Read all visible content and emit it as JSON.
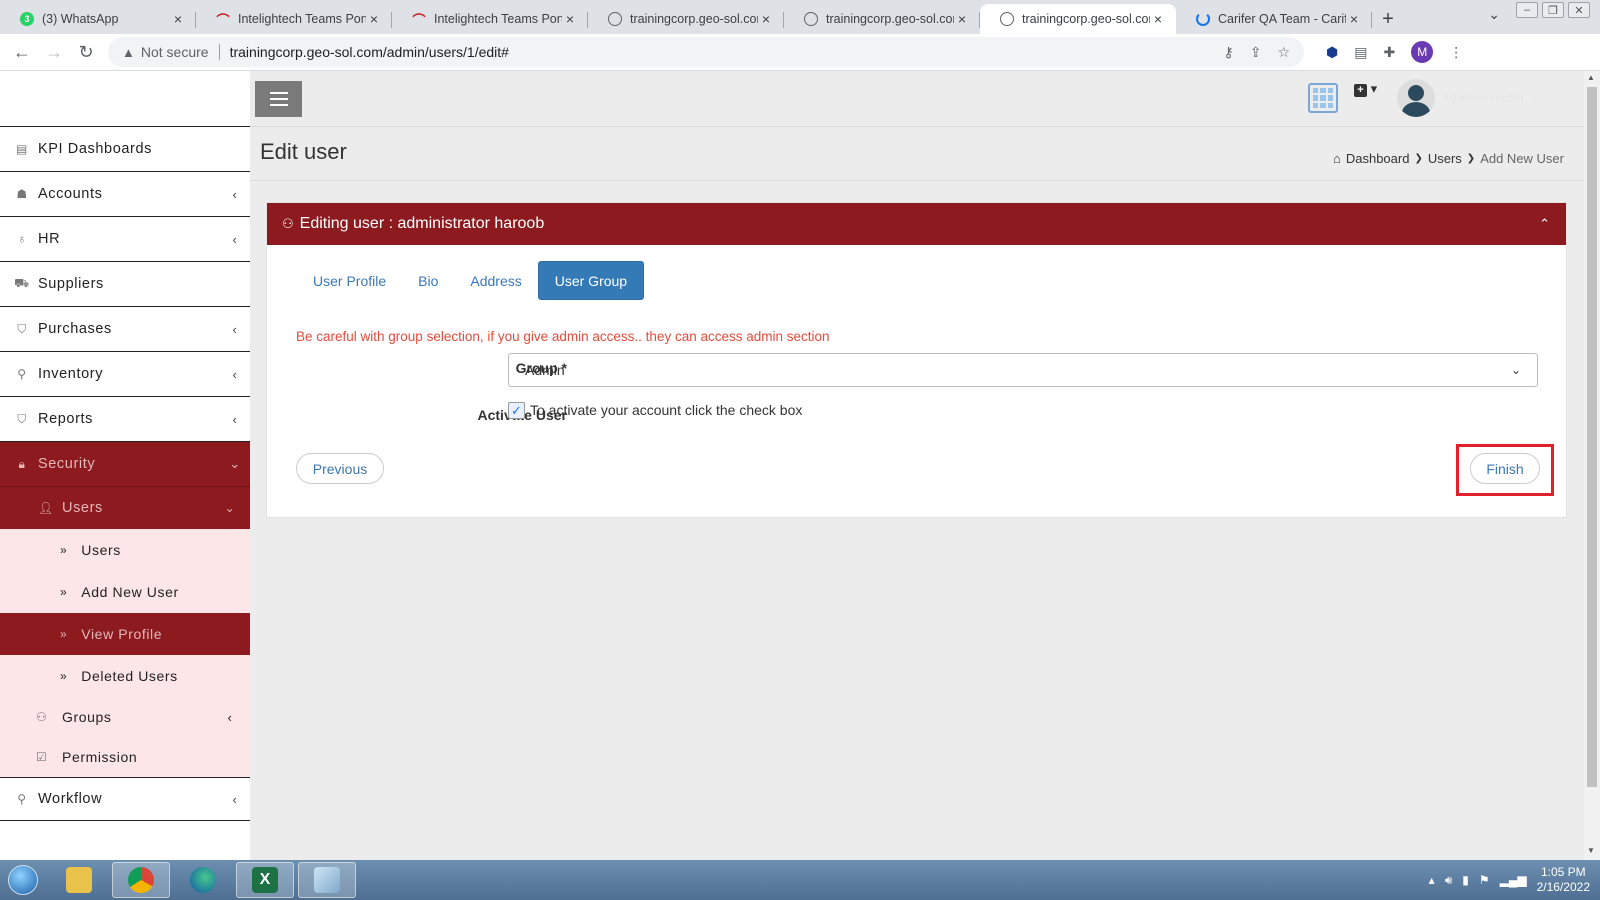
{
  "browser": {
    "tabs": [
      {
        "title": "(3) WhatsApp",
        "icon": "whatsapp-icon",
        "badge": "3"
      },
      {
        "title": "Intelightech Teams Portal",
        "icon": "teams-portal-icon"
      },
      {
        "title": "Intelightech Teams Portal",
        "icon": "teams-portal-icon"
      },
      {
        "title": "trainingcorp.geo-sol.com",
        "icon": "globe-icon"
      },
      {
        "title": "trainingcorp.geo-sol.com",
        "icon": "globe-icon"
      },
      {
        "title": "trainingcorp.geo-sol.com",
        "icon": "globe-icon",
        "active": true
      },
      {
        "title": "Carifer QA Team - Carifer",
        "icon": "carifer-icon"
      }
    ],
    "security_label": "Not secure",
    "url": "trainingcorp.geo-sol.com/admin/users/1/edit#",
    "profile_initial": "M"
  },
  "header": {
    "username": "administrator"
  },
  "sidebar": {
    "items": [
      {
        "label": "KPI Dashboards",
        "icon": "dashboard-icon",
        "has_chevron": false
      },
      {
        "label": "Accounts",
        "icon": "accounts-icon",
        "has_chevron": true
      },
      {
        "label": "HR",
        "icon": "hr-icon",
        "has_chevron": true
      },
      {
        "label": "Suppliers",
        "icon": "truck-icon",
        "has_chevron": false
      },
      {
        "label": "Purchases",
        "icon": "cart-icon",
        "has_chevron": true
      },
      {
        "label": "Inventory",
        "icon": "sitemap-icon",
        "has_chevron": true
      },
      {
        "label": "Reports",
        "icon": "cart-icon",
        "has_chevron": true
      }
    ],
    "security": {
      "label": "Security",
      "users": {
        "label": "Users",
        "children": [
          "Users",
          "Add New User",
          "View Profile",
          "Deleted Users"
        ],
        "active_child": "View Profile"
      },
      "groups_label": "Groups",
      "permission_label": "Permission"
    },
    "workflow_label": "Workflow"
  },
  "content": {
    "page_title": "Edit user",
    "breadcrumb": [
      "Dashboard",
      "Users",
      "Add New User"
    ],
    "panel_title": "Editing user : administrator haroob",
    "tabs": [
      "User Profile",
      "Bio",
      "Address",
      "User Group"
    ],
    "active_tab": "User Group",
    "warning": "Be careful with group selection, if you give admin access.. they can access admin section",
    "group_label": "Group *",
    "group_value": "Admin",
    "activate_label": "Activate User",
    "activate_checked": true,
    "activate_text": "To activate your account click the check box",
    "previous_label": "Previous",
    "finish_label": "Finish"
  },
  "taskbar": {
    "time": "1:05 PM",
    "date": "2/16/2022"
  },
  "colors": {
    "brand": "#8c1a1f",
    "submenu_bg": "#fde6e8",
    "link": "#337ab7",
    "warning": "#e64b3b",
    "highlight": "#e0202a"
  }
}
